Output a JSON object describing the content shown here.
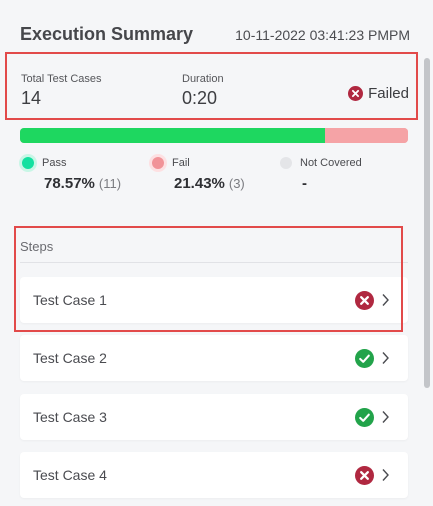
{
  "summary": {
    "title": "Execution Summary",
    "timestamp": "10-11-2022 03:41:23 PMPM",
    "total_label": "Total Test Cases",
    "total_value": "14",
    "duration_label": "Duration",
    "duration_value": "0:20",
    "status_icon": "x-circle-icon",
    "status_text": "Failed"
  },
  "progress": {
    "pass_fraction": 0.7857,
    "pass_color": "#1ed760",
    "fail_color": "#f5a3a6"
  },
  "legend": [
    {
      "name": "pass",
      "label": "Pass",
      "value": "78.57%",
      "count": "(11)",
      "color": "#14e0a0"
    },
    {
      "name": "fail",
      "label": "Fail",
      "value": "21.43%",
      "count": "(3)",
      "color": "#f19398"
    },
    {
      "name": "not-covered",
      "label": "Not Covered",
      "value": "-",
      "count": "",
      "color": "#e4e5e8"
    }
  ],
  "steps": {
    "label": "Steps",
    "items": [
      {
        "name": "Test Case 1",
        "status": "failed",
        "icon": "x-circle-icon"
      },
      {
        "name": "Test Case 2",
        "status": "passed",
        "icon": "check-circle-icon"
      },
      {
        "name": "Test Case 3",
        "status": "passed",
        "icon": "check-circle-icon"
      },
      {
        "name": "Test Case 4",
        "status": "failed",
        "icon": "x-circle-icon"
      }
    ]
  },
  "colors": {
    "failed": "#b02840",
    "passed": "#22a34a",
    "highlight": "#e24a4a"
  }
}
